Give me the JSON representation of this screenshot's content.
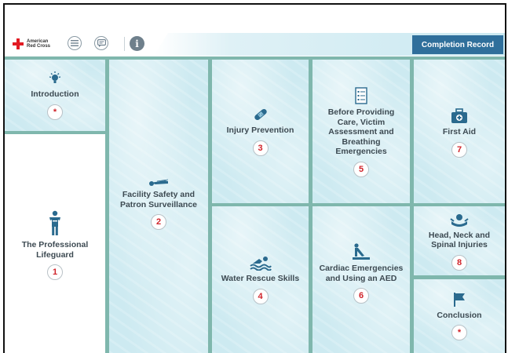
{
  "toolbar": {
    "logo_line1": "American",
    "logo_line2": "Red Cross",
    "menu_icon": "menu-icon",
    "chat_icon": "chat-icon",
    "info_icon": "info-icon",
    "info_glyph": "i",
    "completion_label": "Completion Record"
  },
  "colors": {
    "accent": "#2f6f9b",
    "tile": "#cdeaf1",
    "number": "#d0232a",
    "icon": "#2a6a8e"
  },
  "modules": [
    {
      "label": "Introduction",
      "number": "*",
      "icon": "lightbulb-icon"
    },
    {
      "label": "The Professional Lifeguard",
      "number": "1",
      "icon": "lifeguard-icon"
    },
    {
      "label": "Facility Safety and Patron Surveillance",
      "number": "2",
      "icon": "whistle-icon"
    },
    {
      "label": "Injury Prevention",
      "number": "3",
      "icon": "bandage-icon"
    },
    {
      "label": "Water Rescue Skills",
      "number": "4",
      "icon": "swimmer-icon"
    },
    {
      "label": "Before Providing Care, Victim Assessment and Breathing Emergencies",
      "number": "5",
      "icon": "checklist-icon"
    },
    {
      "label": "Cardiac Emergencies and Using an AED",
      "number": "6",
      "icon": "aed-icon"
    },
    {
      "label": "First Aid",
      "number": "7",
      "icon": "first-aid-kit-icon"
    },
    {
      "label": "Head, Neck and Spinal Injuries",
      "number": "8",
      "icon": "spine-injury-icon"
    },
    {
      "label": "Conclusion",
      "number": "*",
      "icon": "flag-icon"
    }
  ]
}
